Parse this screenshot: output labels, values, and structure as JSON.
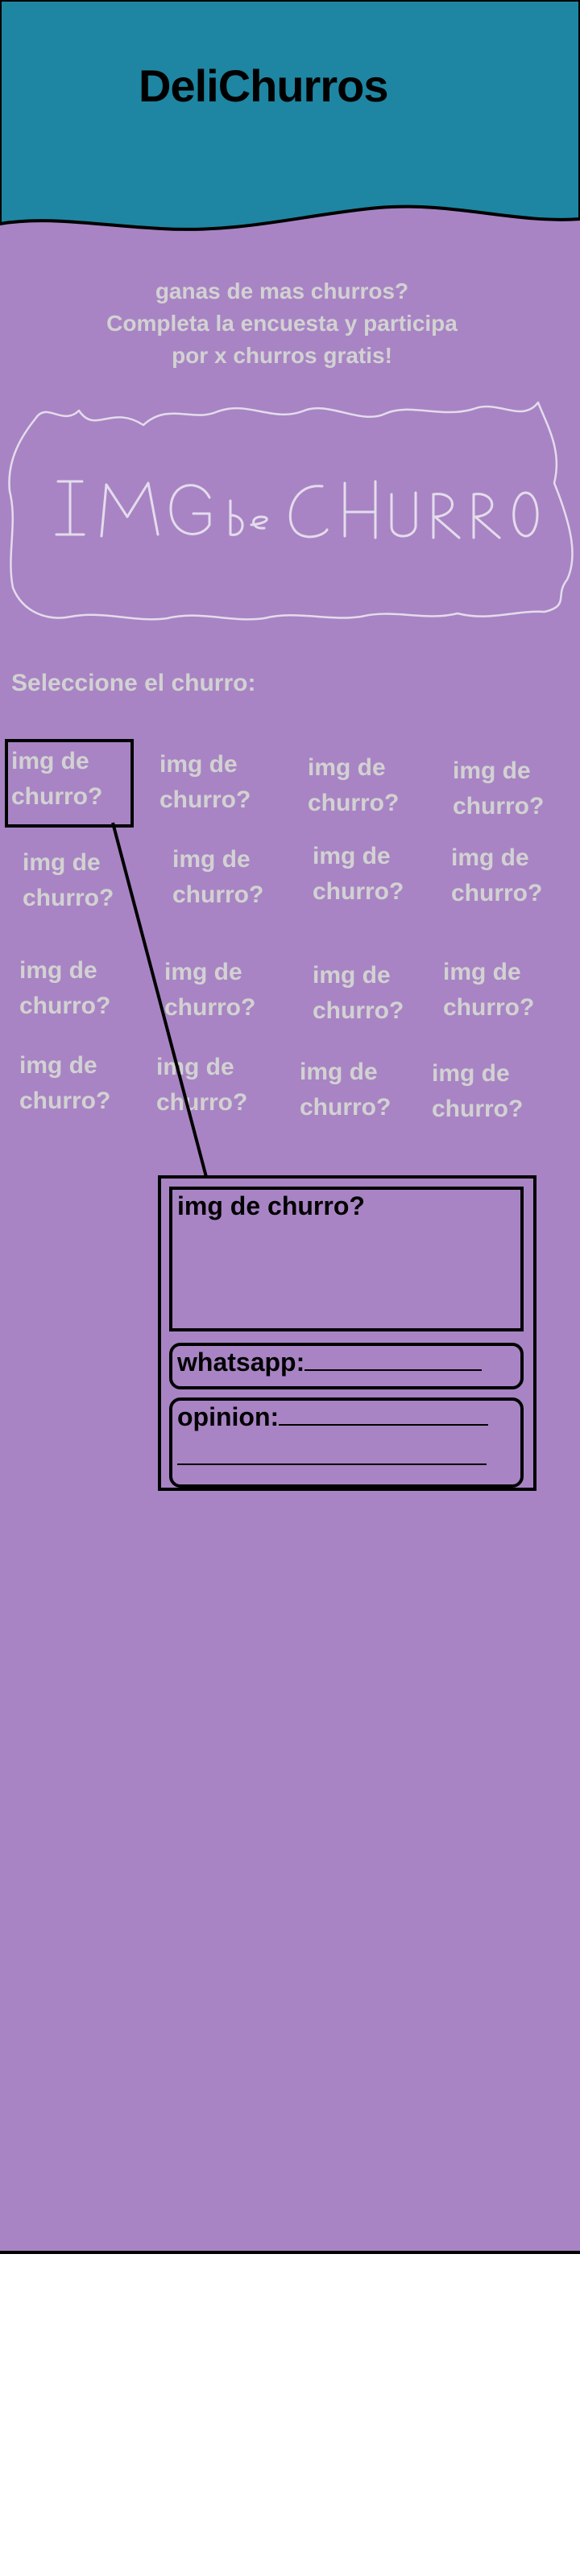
{
  "header": {
    "brand": "DeliChurros",
    "bg_color": "#1e86a2"
  },
  "page_bg_color": "#a884c4",
  "intro": {
    "lines": [
      "ganas de mas churros?",
      "Completa la encuesta y participa",
      "por x churros gratis!"
    ]
  },
  "hero": {
    "sketch_text": "IMG de CHURRO"
  },
  "selection": {
    "label": "Seleccione el churro:",
    "tile_line1": "img de",
    "tile_line2": "churro?",
    "selected_index": 0
  },
  "form": {
    "preview_label": "img de churro?",
    "whatsapp_label": "whatsapp:",
    "opinion_label": "opinion:"
  }
}
